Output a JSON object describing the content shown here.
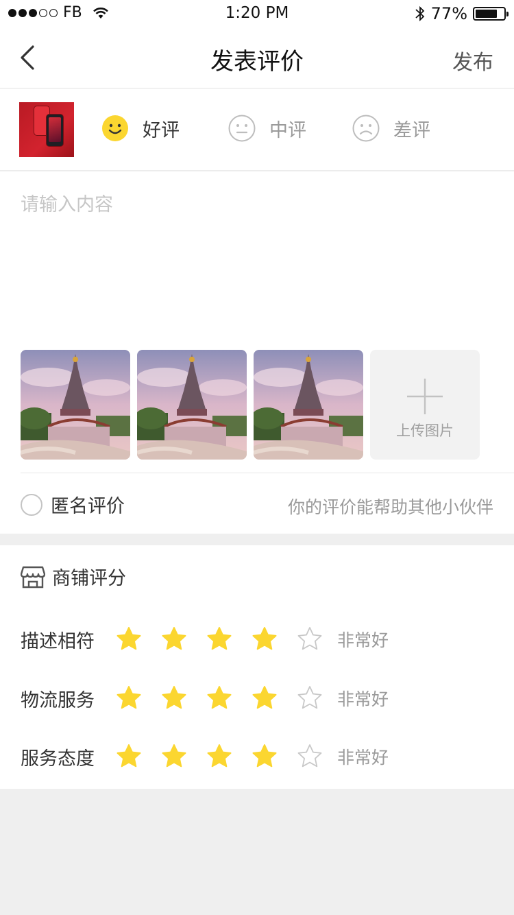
{
  "status_bar": {
    "carrier": "FB",
    "time": "1:20 PM",
    "battery_percent": "77%",
    "battery_level": 0.77
  },
  "nav": {
    "title": "发表评价",
    "publish_label": "发布"
  },
  "rating": {
    "options": [
      {
        "label": "好评",
        "icon": "smile-icon",
        "selected": true
      },
      {
        "label": "中评",
        "icon": "neutral-face-icon",
        "selected": false
      },
      {
        "label": "差评",
        "icon": "sad-face-icon",
        "selected": false
      }
    ],
    "selected_color": "#FBD630"
  },
  "review": {
    "placeholder": "请输入内容",
    "value": "",
    "upload_label": "上传图片"
  },
  "anonymous": {
    "label": "匿名评价",
    "checked": false,
    "hint": "你的评价能帮助其他小伙伴"
  },
  "shop_score": {
    "title": "商铺评分",
    "icon": "shop-icon",
    "star_color": "#FBD630",
    "items": [
      {
        "label": "描述相符",
        "stars": 4,
        "max": 5,
        "text": "非常好"
      },
      {
        "label": "物流服务",
        "stars": 4,
        "max": 5,
        "text": "非常好"
      },
      {
        "label": "服务态度",
        "stars": 4,
        "max": 5,
        "text": "非常好"
      }
    ]
  }
}
